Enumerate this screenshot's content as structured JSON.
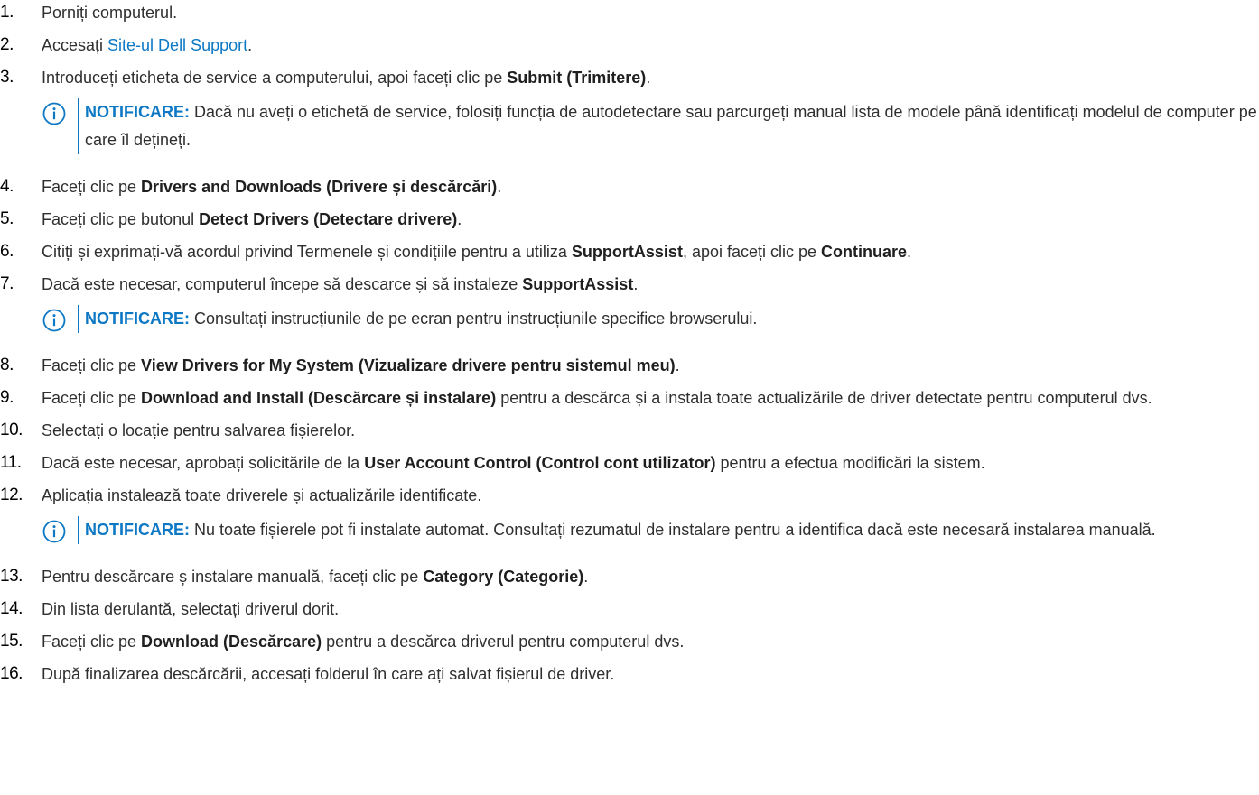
{
  "steps": [
    {
      "num": "1.",
      "parts": [
        {
          "t": "Porniți computerul."
        }
      ]
    },
    {
      "num": "2.",
      "parts": [
        {
          "t": "Accesați "
        },
        {
          "t": "Site-ul Dell Support",
          "link": true
        },
        {
          "t": "."
        }
      ]
    },
    {
      "num": "3.",
      "parts": [
        {
          "t": "Introduceți eticheta de service a computerului, apoi faceți clic pe "
        },
        {
          "t": "Submit (Trimitere)",
          "b": true
        },
        {
          "t": "."
        }
      ],
      "note": "Dacă nu aveți o etichetă de service, folosiți funcția de autodetectare sau parcurgeți manual lista de modele până identificați modelul de computer pe care îl dețineți."
    },
    {
      "num": "4.",
      "parts": [
        {
          "t": "Faceți clic pe "
        },
        {
          "t": "Drivers and Downloads (Drivere și descărcări)",
          "b": true
        },
        {
          "t": "."
        }
      ]
    },
    {
      "num": "5.",
      "parts": [
        {
          "t": "Faceți clic pe butonul "
        },
        {
          "t": "Detect Drivers (Detectare drivere)",
          "b": true
        },
        {
          "t": "."
        }
      ]
    },
    {
      "num": "6.",
      "parts": [
        {
          "t": "Citiți și exprimați-vă acordul privind Termenele și condițiile pentru a utiliza "
        },
        {
          "t": "SupportAssist",
          "b": true
        },
        {
          "t": ", apoi faceți clic pe "
        },
        {
          "t": "Continuare",
          "b": true
        },
        {
          "t": "."
        }
      ]
    },
    {
      "num": "7.",
      "parts": [
        {
          "t": "Dacă este necesar, computerul începe să descarce și să instaleze "
        },
        {
          "t": "SupportAssist",
          "b": true
        },
        {
          "t": "."
        }
      ],
      "note": "Consultați instrucțiunile de pe ecran pentru instrucțiunile specifice browserului."
    },
    {
      "num": "8.",
      "parts": [
        {
          "t": "Faceți clic pe "
        },
        {
          "t": "View Drivers for My System (Vizualizare drivere pentru sistemul meu)",
          "b": true
        },
        {
          "t": "."
        }
      ]
    },
    {
      "num": "9.",
      "parts": [
        {
          "t": "Faceți clic pe "
        },
        {
          "t": "Download and Install (Descărcare și instalare)",
          "b": true
        },
        {
          "t": " pentru a descărca și a instala toate actualizările de driver detectate pentru computerul dvs."
        }
      ]
    },
    {
      "num": "10.",
      "parts": [
        {
          "t": "Selectați o locație pentru salvarea fișierelor."
        }
      ]
    },
    {
      "num": "11.",
      "parts": [
        {
          "t": "Dacă este necesar, aprobați solicitările de la "
        },
        {
          "t": "User Account Control (Control cont utilizator)",
          "b": true
        },
        {
          "t": " pentru a efectua modificări la sistem."
        }
      ]
    },
    {
      "num": "12.",
      "parts": [
        {
          "t": "Aplicația instalează toate driverele și actualizările identificate."
        }
      ],
      "note": "Nu toate fișierele pot fi instalate automat. Consultați rezumatul de instalare pentru a identifica dacă este necesară instalarea manuală."
    },
    {
      "num": "13.",
      "parts": [
        {
          "t": "Pentru descărcare ș instalare manuală, faceți clic pe "
        },
        {
          "t": "Category (Categorie)",
          "b": true
        },
        {
          "t": "."
        }
      ]
    },
    {
      "num": "14.",
      "parts": [
        {
          "t": "Din lista derulantă, selectați driverul dorit."
        }
      ]
    },
    {
      "num": "15.",
      "parts": [
        {
          "t": "Faceți clic pe "
        },
        {
          "t": "Download (Descărcare)",
          "b": true
        },
        {
          "t": " pentru a descărca driverul pentru computerul dvs."
        }
      ]
    },
    {
      "num": "16.",
      "parts": [
        {
          "t": "După finalizarea descărcării, accesați folderul în care ați salvat fișierul de driver."
        }
      ]
    }
  ],
  "note_label": "NOTIFICARE:",
  "colors": {
    "accent": "#0d78c4",
    "text": "#2f2f2f"
  },
  "icons": {
    "note": "info-circle-icon"
  }
}
